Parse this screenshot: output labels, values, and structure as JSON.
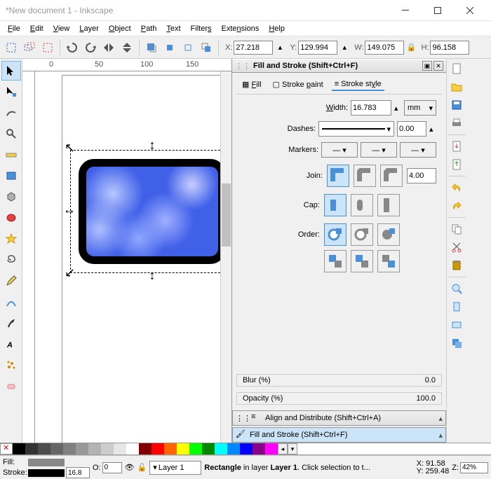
{
  "window": {
    "title": "*New document 1 - Inkscape"
  },
  "menus": [
    "File",
    "Edit",
    "View",
    "Layer",
    "Object",
    "Path",
    "Text",
    "Filters",
    "Extensions",
    "Help"
  ],
  "coords": {
    "x": "27.218",
    "y": "129.994",
    "w": "149.075",
    "h": "96.158"
  },
  "rulers": {
    "h": [
      "0",
      "50",
      "100",
      "150"
    ]
  },
  "panel": {
    "title": "Fill and Stroke (Shift+Ctrl+F)",
    "tabs": {
      "fill": "Fill",
      "stroke_paint": "Stroke paint",
      "stroke_style": "Stroke style"
    },
    "width_label": "Width:",
    "width": "16.783",
    "unit": "mm",
    "dashes_label": "Dashes:",
    "dash_offset": "0.00",
    "markers_label": "Markers:",
    "join_label": "Join:",
    "miter_limit": "4.00",
    "cap_label": "Cap:",
    "order_label": "Order:",
    "blur_label": "Blur (%)",
    "blur": "0.0",
    "opacity_label": "Opacity (%)",
    "opacity": "100.0",
    "align_title": "Align and Distribute (Shift+Ctrl+A)",
    "fs_title": "Fill and Stroke (Shift+Ctrl+F)"
  },
  "swatches": [
    "#000",
    "#333",
    "#4d4d4d",
    "#666",
    "#808080",
    "#999",
    "#b3b3b3",
    "#ccc",
    "#e6e6e6",
    "#fff",
    "#800000",
    "#f00",
    "#f60",
    "#ff0",
    "#0f0",
    "#080",
    "#0ff",
    "#08f",
    "#00f",
    "#808",
    "#f0f"
  ],
  "status": {
    "fill_label": "Fill:",
    "stroke_label": "Stroke:",
    "stroke_width": "16.8",
    "opacity": "0",
    "layer": "Layer 1",
    "message_prefix": "Rectangle",
    "message_mid": " in layer ",
    "message_layer": "Layer 1",
    "message_suffix": ". Click selection to t...",
    "cx": "91.58",
    "cy": "259.48",
    "zoom": "42%",
    "z_label": "Z:",
    "x_label": "X:",
    "y_label": "Y:",
    "o_label": "O:"
  }
}
